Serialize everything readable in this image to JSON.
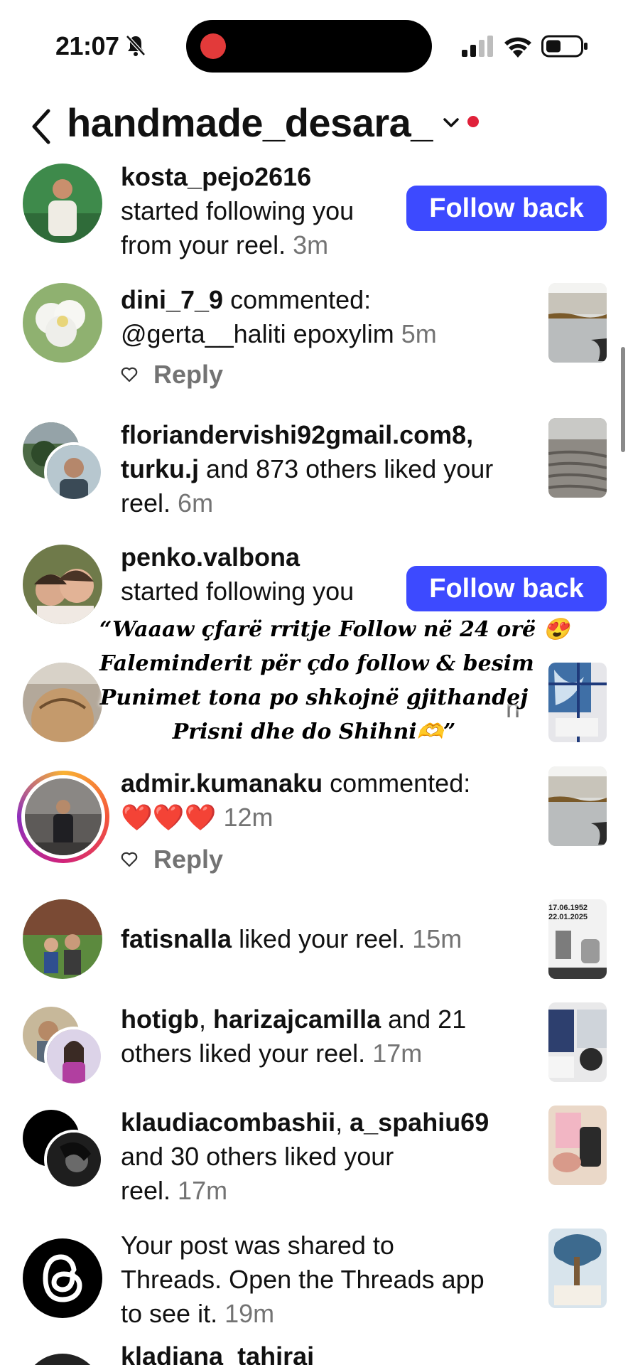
{
  "status_bar": {
    "time": "21:07"
  },
  "header": {
    "title": "handmade_desara_"
  },
  "notifications": [
    {
      "user": "kosta_pejo2616",
      "text": "started following you",
      "text2": "from your reel.",
      "time": "3m",
      "button": "Follow back"
    },
    {
      "user": "dini_7_9",
      "text": " commented:",
      "text2": "@gerta__haliti epoxylim",
      "time": "5m",
      "reply": "Reply"
    },
    {
      "user": "floriandervishi92gmail.com8,",
      "user2": "turku.j",
      "text": " and 873 others liked your",
      "text2": "reel.",
      "time": "6m"
    },
    {
      "user": "penko.valbona",
      "text": "started following you",
      "button": "Follow back"
    },
    {
      "partial_text": "n"
    },
    {
      "user": "admir.kumanaku",
      "text": " commented:",
      "text2": "❤️❤️❤️",
      "time": "12m",
      "reply": "Reply"
    },
    {
      "user": "fatisnalla",
      "text": " liked your reel.",
      "time": "15m",
      "thumb_text": "17.06.1952\n22.01.2025"
    },
    {
      "user": "hotigb",
      "sep": ", ",
      "user2": "harizajcamilla",
      "text": " and 21",
      "text2": "others liked your reel.",
      "time": "17m"
    },
    {
      "user": "klaudiacombashii",
      "sep": ", ",
      "user2": "a_spahiu69",
      "text": "and 30 others liked your",
      "text2": "reel.",
      "time": "17m"
    },
    {
      "text": "Your post was shared to",
      "text2": "Threads. Open the Threads app",
      "text3": "to see it.",
      "time": "19m"
    },
    {
      "user": "kladiana_tahiraj"
    }
  ],
  "overlay": {
    "line1": "“Waaaw çfarë rritje Follow në 24 orë 😍",
    "line2": "Faleminderit për çdo follow & besim",
    "line3": "Punimet tona po shkojnë gjithandej",
    "line4": "Prisni dhe do Shihni🫶”"
  },
  "colors": {
    "accent": "#3d4aff",
    "muted": "#737373",
    "notification_dot": "#e0213a"
  },
  "icons": [
    "bell-slash-icon",
    "signal-icon",
    "wifi-icon",
    "battery-icon",
    "back-chevron-icon",
    "chevron-down-icon",
    "heart-outline-icon",
    "threads-logo-icon"
  ]
}
